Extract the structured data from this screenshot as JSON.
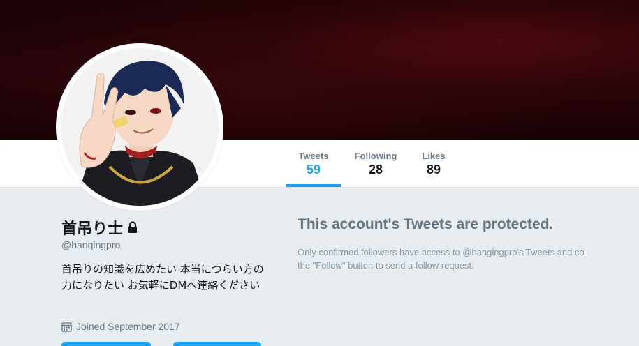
{
  "profile": {
    "name": "首吊り士",
    "handle": "@hangingpro",
    "bio": "首吊りの知識を広めたい 本当につらい方の力になりたい お気軽にDMへ連絡ください",
    "joined": "Joined September 2017"
  },
  "nav": {
    "items": [
      {
        "label": "Tweets",
        "value": "59",
        "active": true
      },
      {
        "label": "Following",
        "value": "28",
        "active": false
      },
      {
        "label": "Likes",
        "value": "89",
        "active": false
      }
    ]
  },
  "protected": {
    "title": "This account's Tweets are protected.",
    "line1": "Only confirmed followers have access to @hangingpro's Tweets and co",
    "line2": "the \"Follow\" button to send a follow request."
  },
  "icons": {
    "lock": "lock-icon",
    "calendar": "calendar-icon"
  },
  "colors": {
    "accent": "#1da1f2",
    "banner": "#1a0306",
    "background": "#e6ecf0"
  }
}
